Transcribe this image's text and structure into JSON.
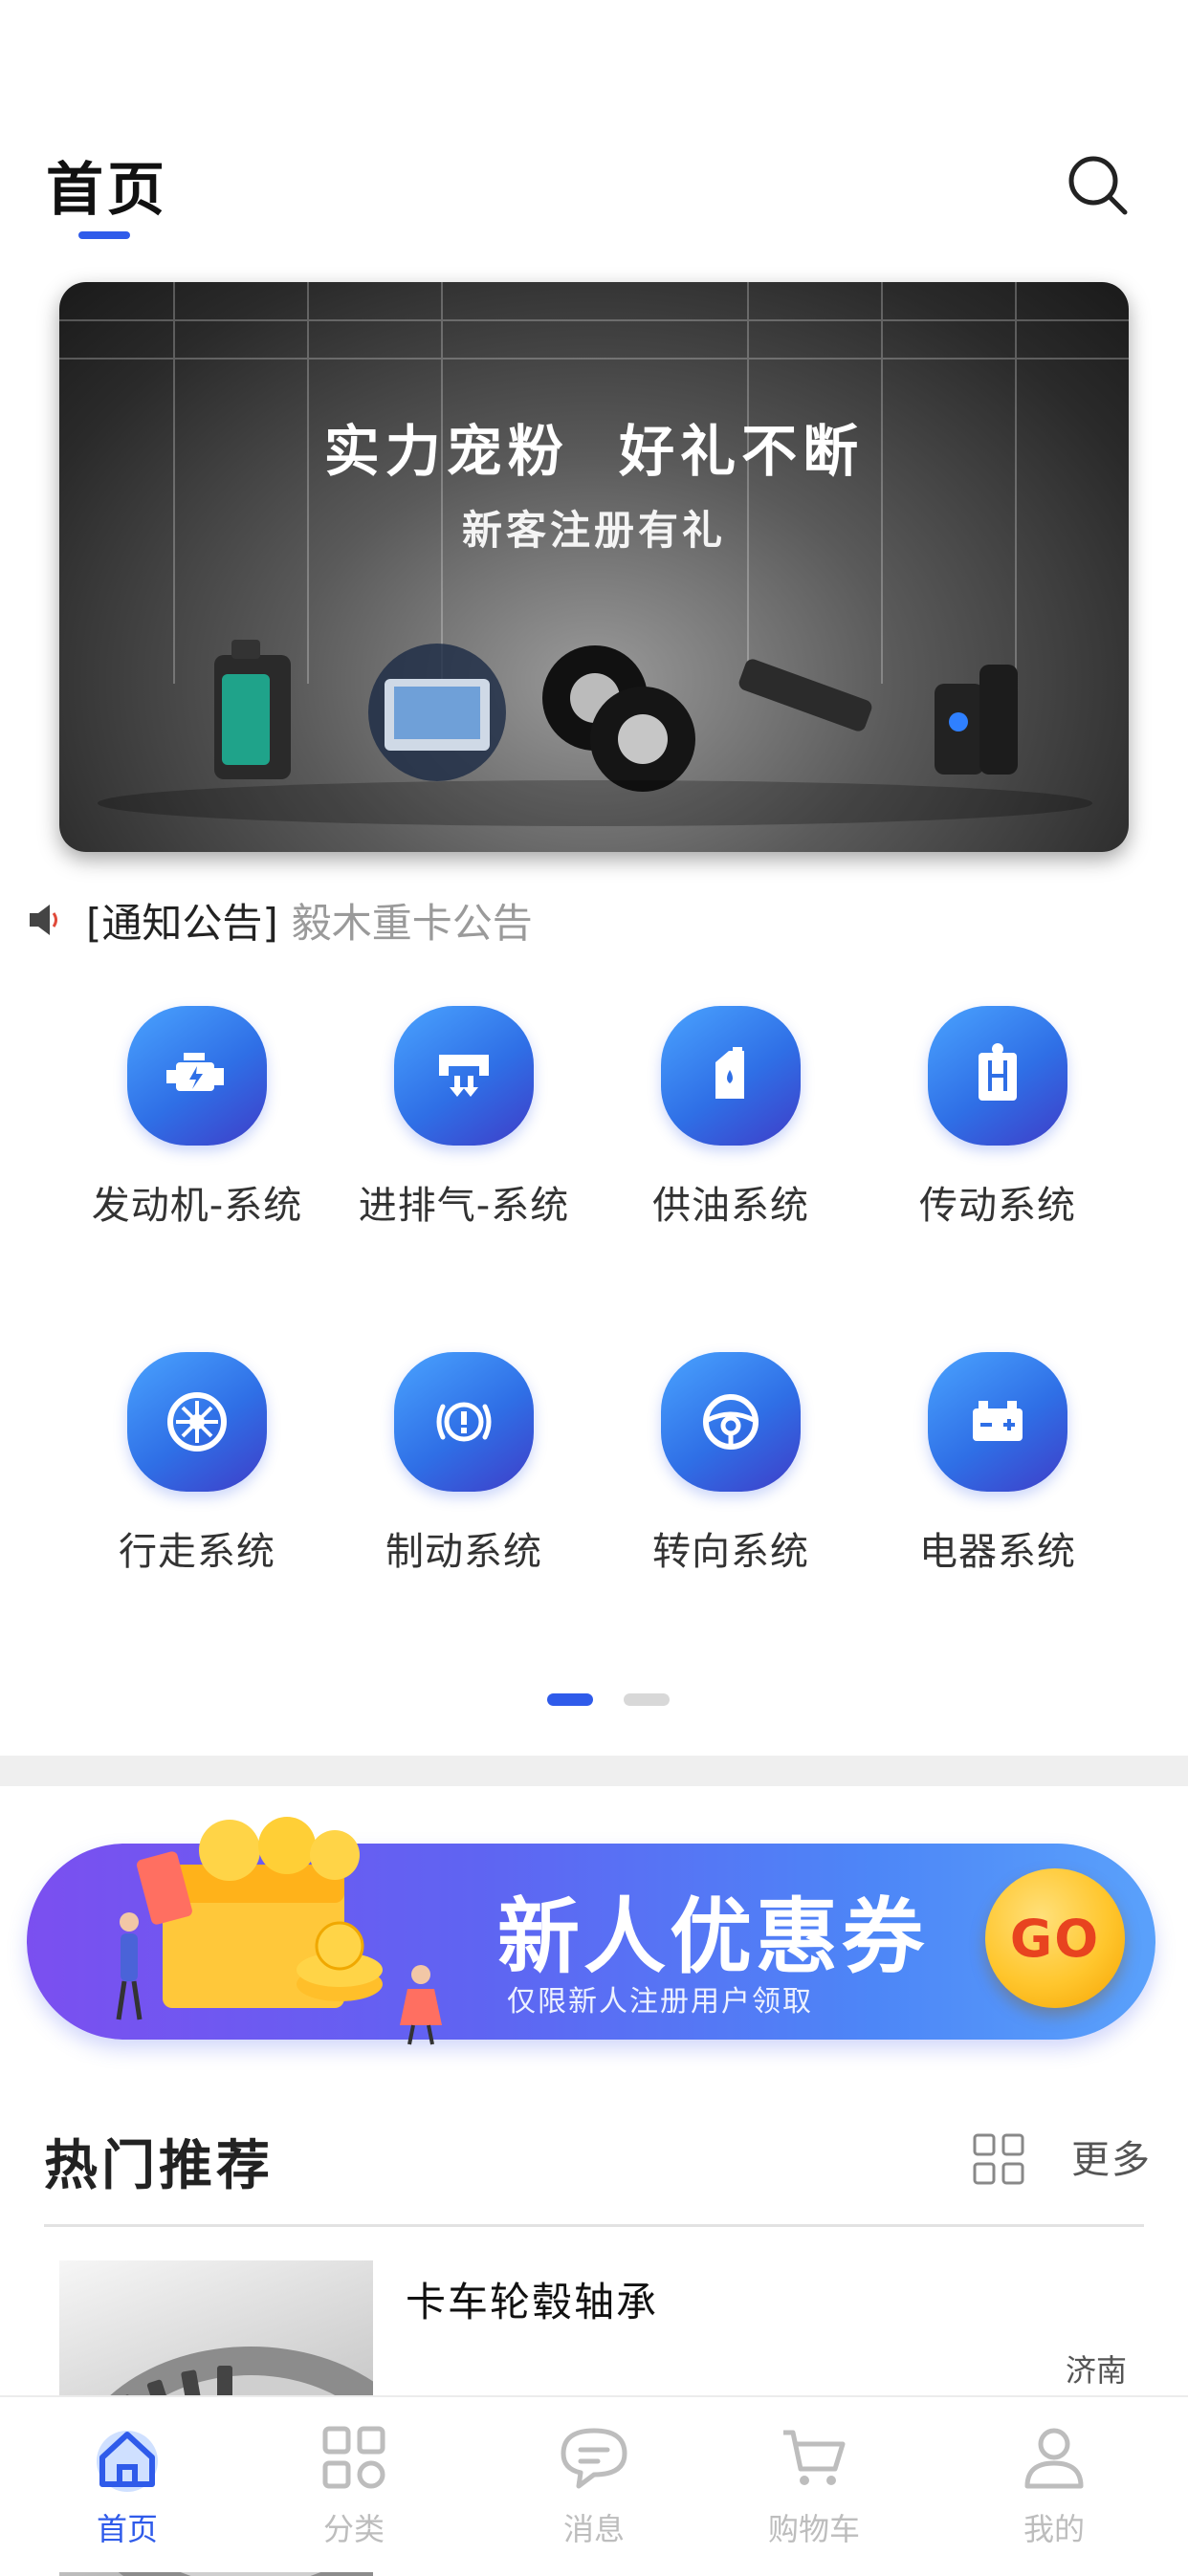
{
  "header": {
    "title": "首页"
  },
  "banner": {
    "headline": "实力宠粉  好礼不断",
    "subtitle": "新客注册有礼"
  },
  "notice": {
    "tag": "[通知公告]",
    "text": "毅木重卡公告"
  },
  "categories": [
    {
      "label": "发动机-系统",
      "icon": "engine-icon"
    },
    {
      "label": "进排气-系统",
      "icon": "intake-exhaust-icon"
    },
    {
      "label": "供油系统",
      "icon": "fuel-can-icon"
    },
    {
      "label": "传动系统",
      "icon": "gearshift-icon"
    },
    {
      "label": "行走系统",
      "icon": "wheel-icon"
    },
    {
      "label": "制动系统",
      "icon": "brake-warning-icon"
    },
    {
      "label": "转向系统",
      "icon": "steering-wheel-icon"
    },
    {
      "label": "电器系统",
      "icon": "battery-icon"
    }
  ],
  "pager": {
    "current": 1,
    "total": 2
  },
  "coupon": {
    "title": "新人优惠券",
    "subtitle": "仅限新人注册用户领取",
    "go_label": "GO"
  },
  "hot": {
    "title": "热门推荐",
    "more_label": "更多",
    "products": [
      {
        "name": "卡车轮毂轴承",
        "city": "济南"
      }
    ]
  },
  "tabs": [
    {
      "label": "首页",
      "icon": "home-icon",
      "active": true
    },
    {
      "label": "分类",
      "icon": "category-grid-icon",
      "active": false
    },
    {
      "label": "消息",
      "icon": "message-icon",
      "active": false
    },
    {
      "label": "购物车",
      "icon": "cart-icon",
      "active": false
    },
    {
      "label": "我的",
      "icon": "profile-icon",
      "active": false
    }
  ],
  "colors": {
    "accent": "#2f5bea",
    "tab_inactive": "#bdbdbd"
  }
}
